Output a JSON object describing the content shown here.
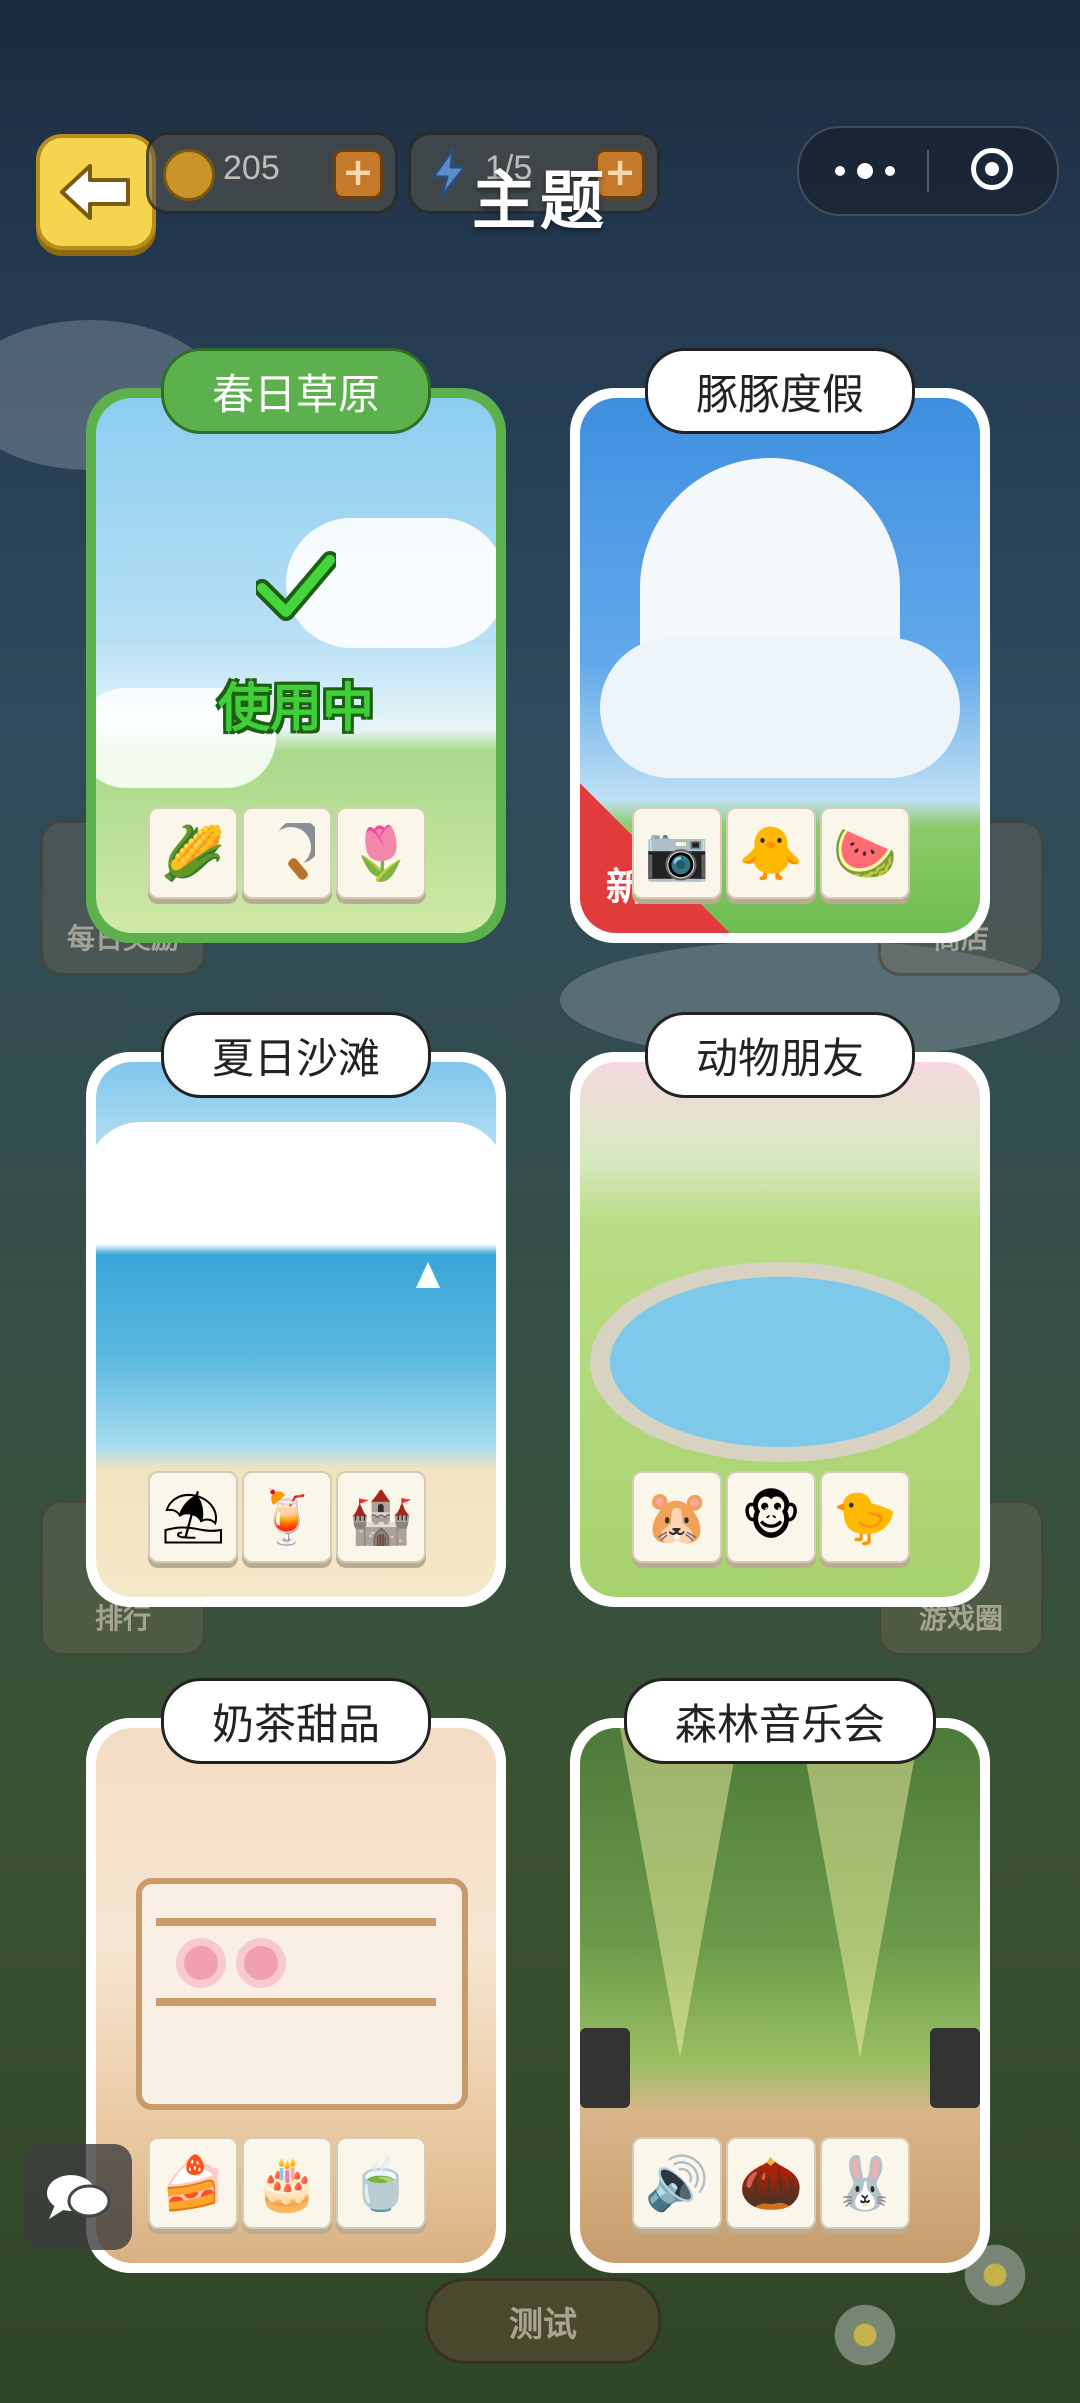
{
  "header": {
    "title": "主题",
    "coins": "205",
    "energy": "1/5"
  },
  "background": {
    "buttons": [
      "每日奖励",
      "商店",
      "排行",
      "游戏圈"
    ],
    "test_button": "测试"
  },
  "themes": [
    {
      "name": "春日草原",
      "status": "使用中",
      "active": true,
      "is_new": false,
      "items": [
        "corn",
        "sickle",
        "tulip"
      ]
    },
    {
      "name": "豚豚度假",
      "status": "",
      "active": false,
      "is_new": true,
      "new_badge": "新",
      "items": [
        "camera",
        "chick-sunglasses",
        "capybara-watermelon"
      ]
    },
    {
      "name": "夏日沙滩",
      "status": "",
      "active": false,
      "is_new": false,
      "items": [
        "beach-umbrella",
        "lemonade",
        "sandcastle"
      ]
    },
    {
      "name": "动物朋友",
      "status": "",
      "active": false,
      "is_new": false,
      "items": [
        "capybara",
        "monkey",
        "chick"
      ]
    },
    {
      "name": "奶茶甜品",
      "status": "",
      "active": false,
      "is_new": false,
      "items": [
        "cake-slice",
        "strawberry-cake",
        "matcha-drink"
      ]
    },
    {
      "name": "森林音乐会",
      "status": "",
      "active": false,
      "is_new": false,
      "items": [
        "speaker",
        "acorn",
        "rabbit-guitar"
      ]
    }
  ],
  "colors": {
    "active_card": "#5cb14e",
    "back_button": "#f6d54e",
    "new_badge": "#e23b3b"
  }
}
